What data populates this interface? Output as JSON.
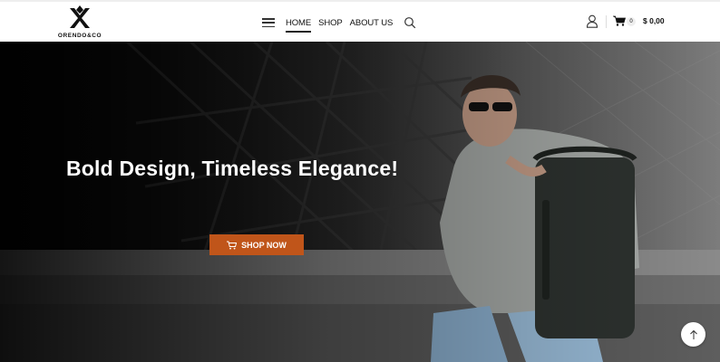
{
  "brand": {
    "name": "ORENDO&CO"
  },
  "nav": {
    "items": [
      {
        "label": "HOME",
        "active": true
      },
      {
        "label": "SHOP",
        "active": false
      },
      {
        "label": "ABOUT US",
        "active": false
      }
    ]
  },
  "cart": {
    "count": "0",
    "total": "$ 0,00"
  },
  "hero": {
    "title": "Bold Design, Timeless Elegance!",
    "cta_label": "SHOP NOW"
  },
  "colors": {
    "accent": "#c0551a",
    "header_bg": "#ffffff",
    "text": "#111111"
  },
  "icons": [
    "menu-icon",
    "search-icon",
    "user-icon",
    "cart-icon",
    "arrow-up-icon"
  ]
}
